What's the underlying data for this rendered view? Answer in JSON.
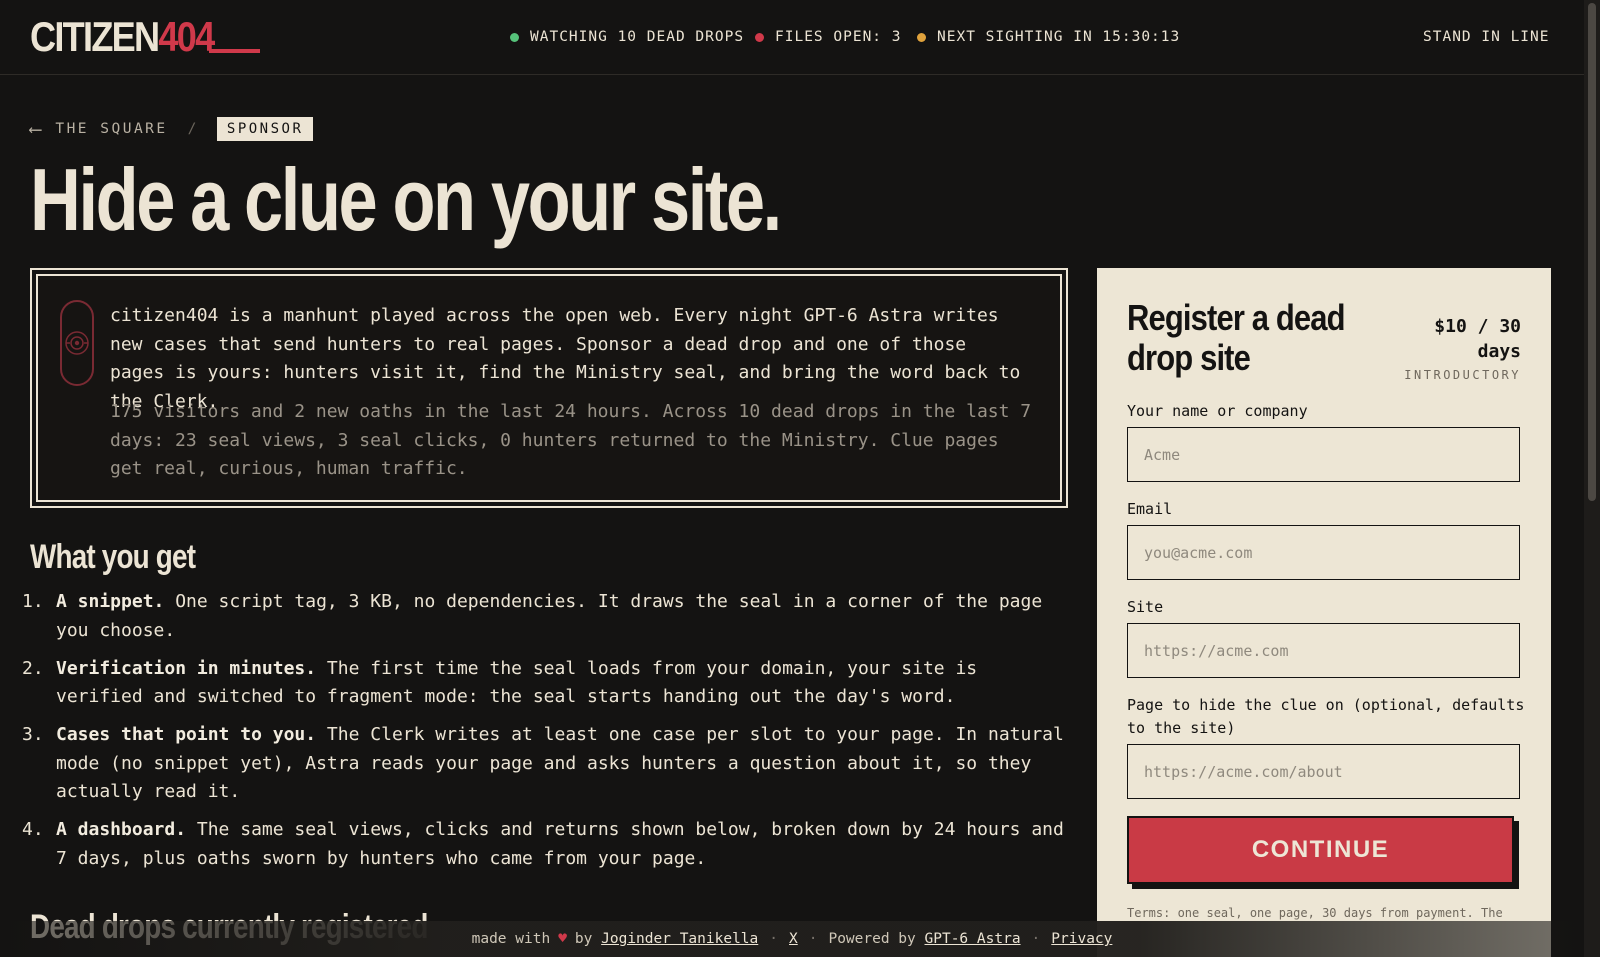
{
  "header": {
    "logo_part1": "CITIZEN",
    "logo_part2": "404",
    "status": [
      {
        "label": "WATCHING 10 DEAD DROPS",
        "color": "#56c27a"
      },
      {
        "label": "FILES OPEN: 3",
        "color": "#d0394a"
      },
      {
        "label": "NEXT SIGHTING IN 15:30:13",
        "color": "#e0a23c"
      }
    ],
    "cta": "STAND IN LINE"
  },
  "breadcrumb": {
    "back": "THE SQUARE",
    "separator": "/",
    "current": "SPONSOR"
  },
  "page_title": "Hide a clue on your site.",
  "intro": {
    "p1": "citizen404 is a manhunt played across the open web. Every night GPT-6 Astra writes new cases that send hunters to real pages. Sponsor a dead drop and one of those pages is yours: hunters visit it, find the Ministry seal, and bring the word back to the Clerk.",
    "p2": "175 visitors and 2 new oaths in the last 24 hours. Across 10 dead drops in the last 7 days: 23 seal views, 3 seal clicks, 0 hunters returned to the Ministry. Clue pages get real, curious, human traffic."
  },
  "what_you_get": {
    "heading": "What you get",
    "items": [
      {
        "num": "1.",
        "bold": "A snippet.",
        "text": " One script tag, 3 KB, no dependencies. It draws the seal in a corner of the page you choose."
      },
      {
        "num": "2.",
        "bold": "Verification in minutes.",
        "text": " The first time the seal loads from your domain, your site is verified and switched to fragment mode: the seal starts handing out the day's word."
      },
      {
        "num": "3.",
        "bold": "Cases that point to you.",
        "text": " The Clerk writes at least one case per slot to your page. In natural mode (no snippet yet), Astra reads your page and asks hunters a question about it, so they actually read it."
      },
      {
        "num": "4.",
        "bold": "A dashboard.",
        "text": " The same seal views, clicks and returns shown below, broken down by 24 hours and 7 days, plus oaths sworn by hunters who came from your page."
      }
    ]
  },
  "next_heading": "Dead drops currently registered",
  "form": {
    "title": "Register a dead drop site",
    "price": "$10 / 30 days",
    "price_tag": "INTRODUCTORY",
    "name_label": "Your name or company",
    "name_placeholder": "Acme",
    "email_label": "Email",
    "email_placeholder": "you@acme.com",
    "site_label": "Site",
    "site_placeholder": "https://acme.com",
    "page_label": "Page to hide the clue on (optional, defaults to the site)",
    "page_placeholder": "https://acme.com/about",
    "submit": "CONTINUE",
    "terms": "Terms: one seal, one page, 30 days from payment. The"
  },
  "footer": {
    "made_with": "made with",
    "by": "by",
    "author": "Joginder Tanikella",
    "x_link": "X",
    "powered_by": "Powered by",
    "powered_link": "GPT-6 Astra",
    "privacy": "Privacy",
    "separator": "·"
  }
}
